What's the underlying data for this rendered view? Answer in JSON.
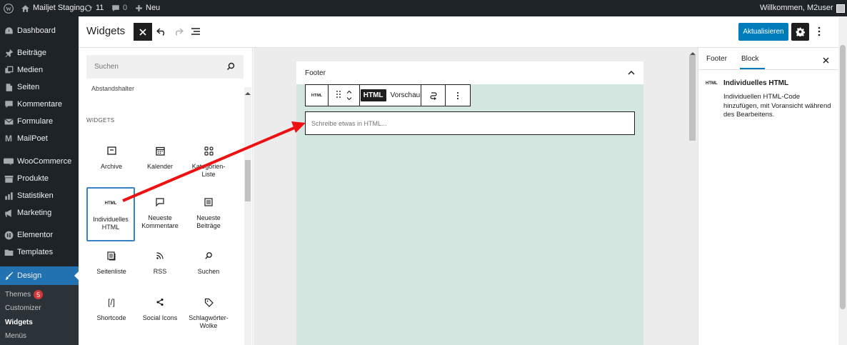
{
  "admin_bar": {
    "site_name": "Mailjet Staging",
    "updates_count": "11",
    "comments_count": "0",
    "new_label": "Neu",
    "welcome_text": "Willkommen, M2user"
  },
  "sidebar": {
    "items": [
      {
        "label": "Dashboard",
        "icon": "dashboard-icon"
      },
      {
        "label": "Beiträge",
        "icon": "pin-icon"
      },
      {
        "label": "Medien",
        "icon": "media-icon"
      },
      {
        "label": "Seiten",
        "icon": "page-icon"
      },
      {
        "label": "Kommentare",
        "icon": "comment-icon"
      },
      {
        "label": "Formulare",
        "icon": "mail-icon"
      },
      {
        "label": "MailPoet",
        "icon": "mailpoet-icon"
      },
      {
        "label": "WooCommerce",
        "icon": "woo-icon"
      },
      {
        "label": "Produkte",
        "icon": "archive-icon"
      },
      {
        "label": "Statistiken",
        "icon": "chart-icon"
      },
      {
        "label": "Marketing",
        "icon": "megaphone-icon"
      },
      {
        "label": "Elementor",
        "icon": "elementor-icon"
      },
      {
        "label": "Templates",
        "icon": "folder-icon"
      },
      {
        "label": "Design",
        "icon": "brush-icon"
      }
    ],
    "submenu": {
      "themes_label": "Themes",
      "themes_badge": "5",
      "customizer_label": "Customizer",
      "widgets_label": "Widgets",
      "menus_label": "Menüs"
    }
  },
  "header": {
    "title": "Widgets",
    "update_label": "Aktualisieren"
  },
  "inserter": {
    "search_placeholder": "Suchen",
    "cut_item_label": "Abstandshalter",
    "section_title": "WIDGETS",
    "blocks": [
      {
        "label": "Archive",
        "icon": "archive-icon"
      },
      {
        "label": "Kalender",
        "icon": "calendar-icon"
      },
      {
        "label": "Kategorien-Liste",
        "icon": "categories-icon"
      },
      {
        "label": "Individuelles HTML",
        "icon": "html-icon",
        "icon_text": "HTML"
      },
      {
        "label": "Neueste Kommentare",
        "icon": "comment-icon"
      },
      {
        "label": "Neueste Beiträge",
        "icon": "posts-icon"
      },
      {
        "label": "Seitenliste",
        "icon": "page-list-icon"
      },
      {
        "label": "RSS",
        "icon": "rss-icon"
      },
      {
        "label": "Suchen",
        "icon": "search-icon"
      },
      {
        "label": "Shortcode",
        "icon": "shortcode-icon",
        "icon_text": "[/]"
      },
      {
        "label": "Social Icons",
        "icon": "share-icon"
      },
      {
        "label": "Schlagwörter-Wolke",
        "icon": "tag-icon"
      }
    ]
  },
  "canvas": {
    "area_title": "Footer",
    "toolbar": {
      "block_icon_text": "HTML",
      "html_tab": "HTML",
      "preview_tab": "Vorschau"
    },
    "html_placeholder": "Schreibe etwas in HTML..."
  },
  "right_sidebar": {
    "tab_footer": "Footer",
    "tab_block": "Block",
    "block_icon_text": "HTML",
    "block_title": "Individuelles HTML",
    "block_description": "Individuellen HTML-Code hinzufügen, mit Voransicht während des Bearbeitens."
  },
  "colors": {
    "accent": "#007cba",
    "admin_dark": "#1d2327",
    "footer_bg": "#d3e6e0",
    "annotation_arrow": "#ee1111"
  }
}
